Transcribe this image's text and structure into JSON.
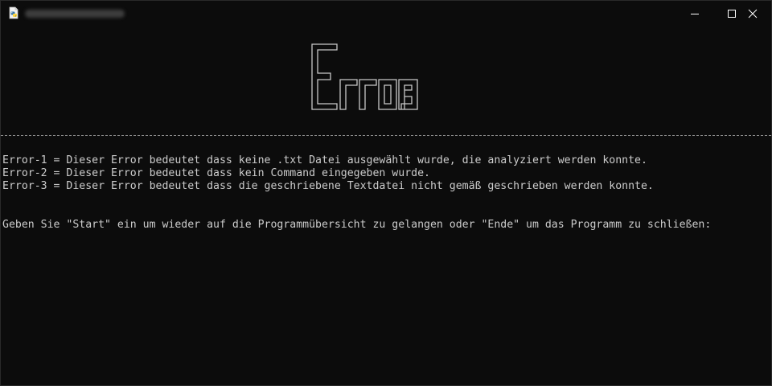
{
  "titlebar": {
    "app_icon": "python-file-icon",
    "title_obscured": true,
    "controls": {
      "minimize_icon": "minimize-icon",
      "maximize_icon": "maximize-icon",
      "close_icon": "close-icon"
    }
  },
  "console": {
    "ascii_logo_text": "Error",
    "errors": [
      "Error-1 = Dieser Error bedeutet dass keine .txt Datei ausgewählt wurde, die analyziert werden konnte.",
      "Error-2 = Dieser Error bedeutet dass kein Command eingegeben wurde.",
      "Error-3 = Dieser Error bedeutet dass die geschriebene Textdatei nicht gemäß geschrieben werden konnte."
    ],
    "prompt": "Geben Sie \"Start\" ein um wieder auf die Programmübersicht zu gelangen oder \"Ende\" um das Programm zu schließen:"
  },
  "colors": {
    "background": "#0c0c0c",
    "text": "#cccccc",
    "logo_stroke": "#c8c8c8"
  }
}
